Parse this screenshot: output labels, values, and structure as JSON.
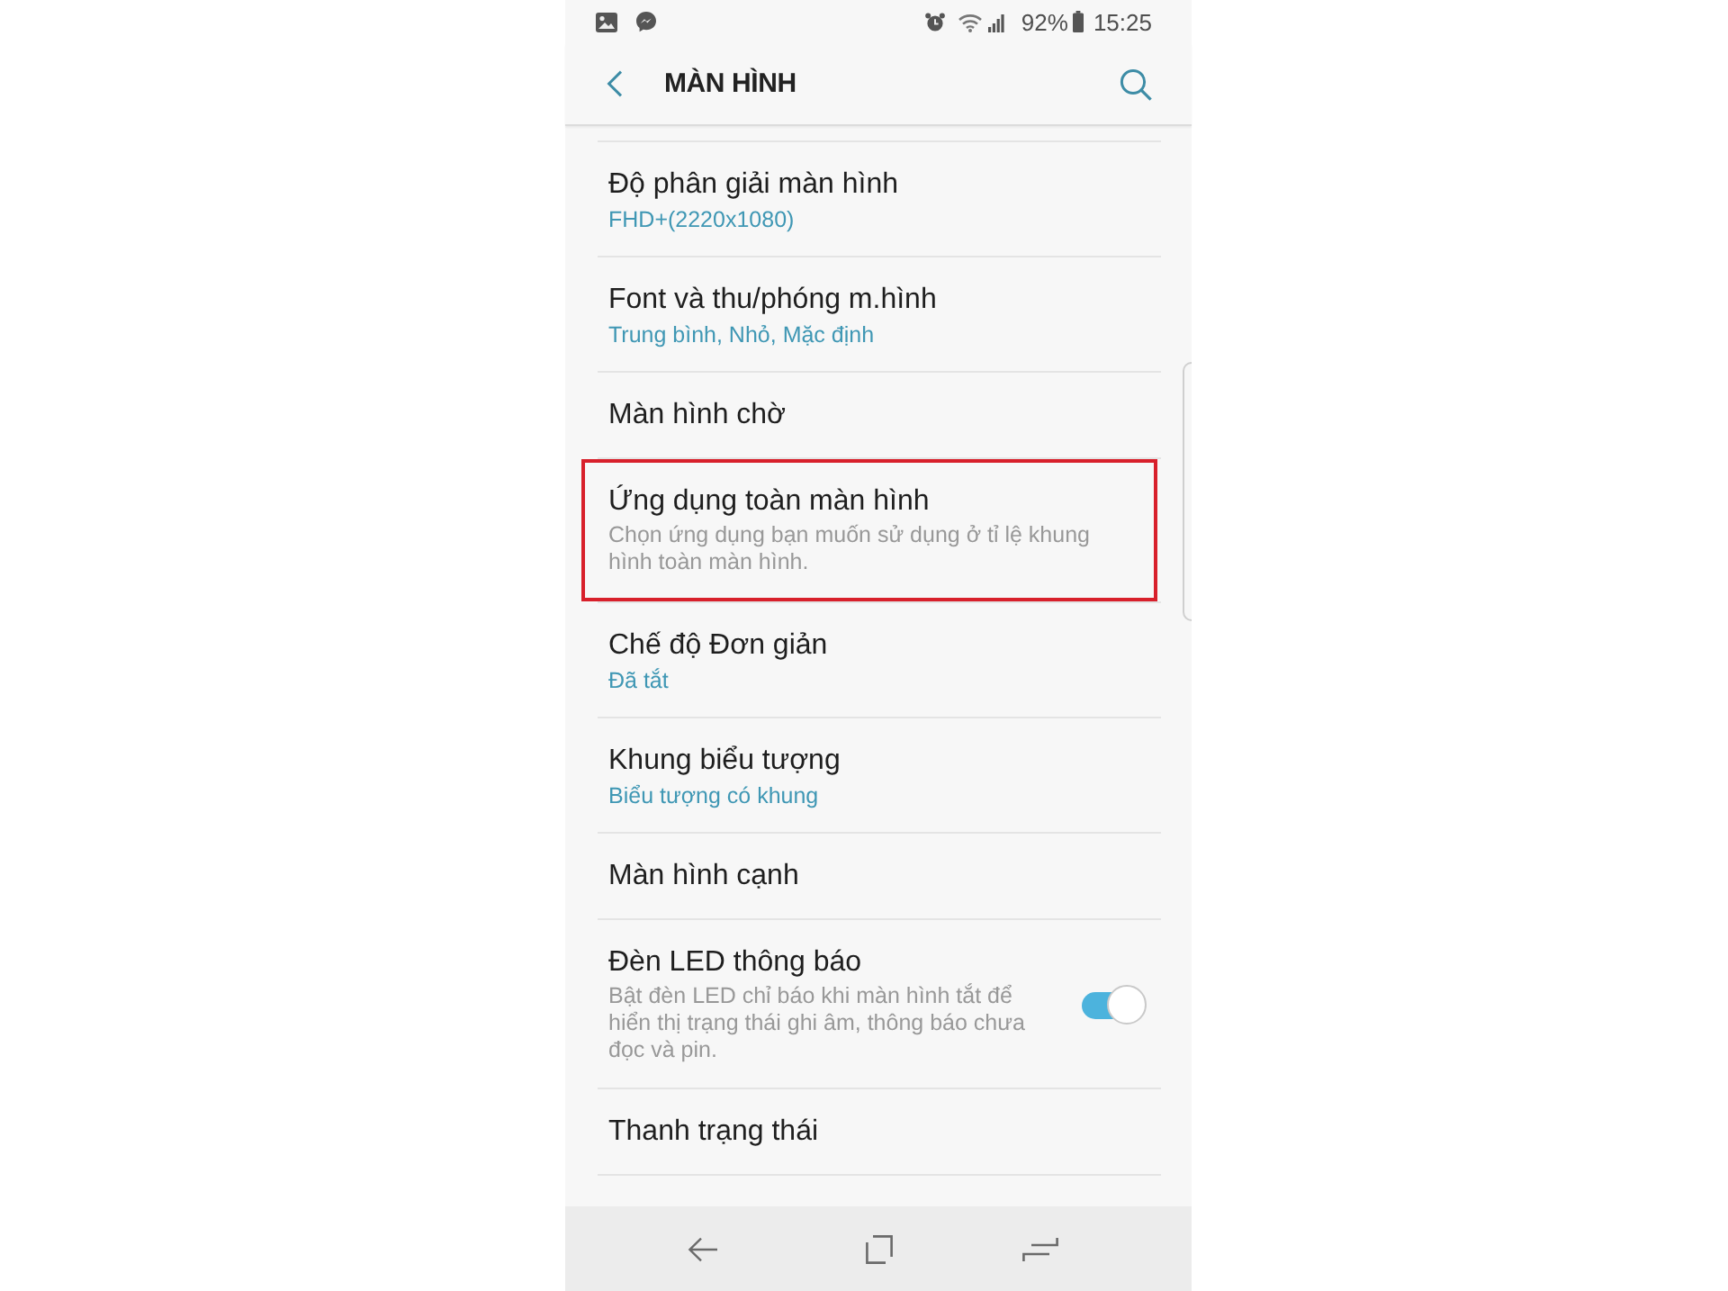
{
  "status_bar": {
    "battery": "92%",
    "time": "15:25"
  },
  "app_bar": {
    "title": "MÀN HÌNH"
  },
  "settings": [
    {
      "kind": "value",
      "title": "Độ phân giải màn hình",
      "value": "FHD+(2220x1080)",
      "highlighted": false
    },
    {
      "kind": "value",
      "title": "Font và thu/phóng m.hình",
      "value": "Trung bình, Nhỏ, Mặc định",
      "highlighted": false
    },
    {
      "kind": "plain",
      "title": "Màn hình chờ",
      "highlighted": false
    },
    {
      "kind": "description",
      "title": "Ứng dụng toàn màn hình",
      "description": "Chọn ứng dụng bạn muốn sử dụng ở tỉ lệ khung hình toàn màn hình.",
      "highlighted": true
    },
    {
      "kind": "value",
      "title": "Chế độ Đơn giản",
      "value": "Đã tắt",
      "highlighted": false
    },
    {
      "kind": "value",
      "title": "Khung biểu tượng",
      "value": "Biểu tượng có khung",
      "highlighted": false
    },
    {
      "kind": "plain",
      "title": "Màn hình cạnh",
      "highlighted": false
    },
    {
      "kind": "switch",
      "title": "Đèn LED thông báo",
      "description": "Bật đèn LED chỉ báo khi màn hình tắt để hiển thị trạng thái ghi âm, thông báo chưa đọc và pin.",
      "on": true,
      "highlighted": false
    },
    {
      "kind": "plain",
      "title": "Thanh trạng thái",
      "highlighted": false
    }
  ]
}
